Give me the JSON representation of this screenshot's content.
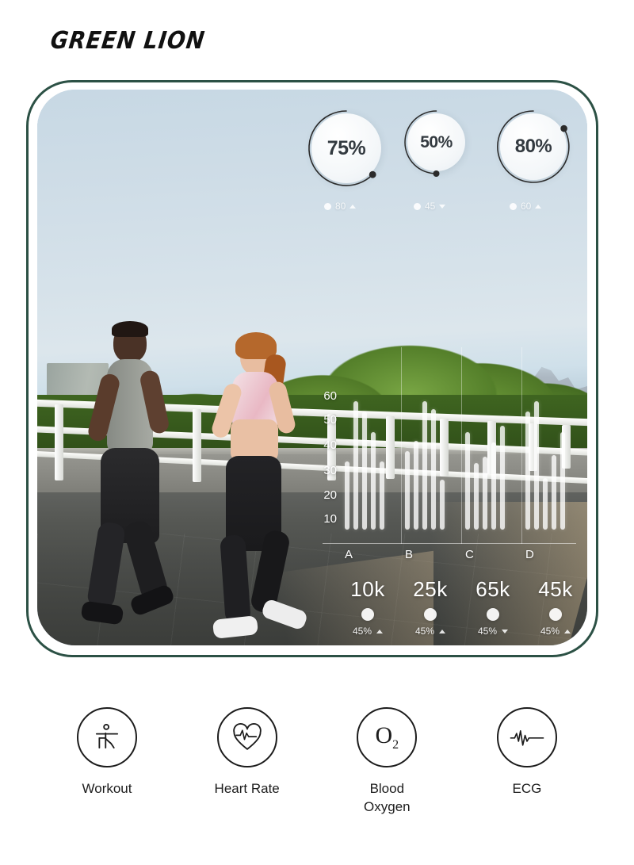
{
  "brand": {
    "name": "GREEN LION"
  },
  "frame": {
    "border_color": "#2c5145"
  },
  "gauges": [
    {
      "name": "gauge-75",
      "value": "75%",
      "percent": 75,
      "meta_value": "80",
      "trend": "up",
      "icon": "triangle-up-icon"
    },
    {
      "name": "gauge-50",
      "value": "50%",
      "percent": 50,
      "meta_value": "45",
      "trend": "down",
      "icon": "triangle-down-icon"
    },
    {
      "name": "gauge-80",
      "value": "80%",
      "percent": 80,
      "meta_value": "60",
      "trend": "up",
      "icon": "triangle-up-icon"
    }
  ],
  "chart_data": {
    "type": "bar",
    "title": "",
    "xlabel": "",
    "ylabel": "",
    "ylim": [
      0,
      65
    ],
    "grid": false,
    "legend": "none",
    "y_ticks": [
      "60",
      "50",
      "40",
      "30",
      "20",
      "10"
    ],
    "categories": [
      "A",
      "B",
      "C",
      "D"
    ],
    "series": [
      {
        "name": "A",
        "values": [
          33,
          62,
          57,
          47,
          33
        ]
      },
      {
        "name": "B",
        "values": [
          38,
          43,
          62,
          58,
          24
        ]
      },
      {
        "name": "C",
        "values": [
          47,
          32,
          35,
          42,
          50
        ]
      },
      {
        "name": "D",
        "values": [
          57,
          62,
          25,
          36,
          47
        ]
      }
    ]
  },
  "stats": [
    {
      "value": "10k",
      "change": "45%",
      "trend": "up",
      "icon": "triangle-up-icon"
    },
    {
      "value": "25k",
      "change": "45%",
      "trend": "up",
      "icon": "triangle-up-icon"
    },
    {
      "value": "65k",
      "change": "45%",
      "trend": "down",
      "icon": "triangle-down-icon"
    },
    {
      "value": "45k",
      "change": "45%",
      "trend": "up",
      "icon": "triangle-up-icon"
    }
  ],
  "features": [
    {
      "label": "Workout",
      "icon": "workout-person-icon"
    },
    {
      "label": "Heart Rate",
      "icon": "heart-pulse-icon"
    },
    {
      "label": "Blood\nOxygen",
      "icon": "blood-oxygen-o2-icon"
    },
    {
      "label": "ECG",
      "icon": "ecg-waveform-icon"
    }
  ]
}
